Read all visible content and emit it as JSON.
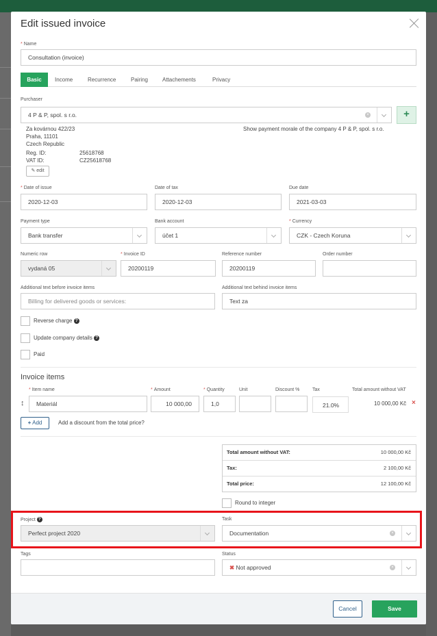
{
  "modal": {
    "title": "Edit issued invoice"
  },
  "name_field": {
    "label": "Name",
    "value": "Consultation (invoice)"
  },
  "tabs": [
    {
      "label": "Basic"
    },
    {
      "label": "Income"
    },
    {
      "label": "Recurrence"
    },
    {
      "label": "Pairing"
    },
    {
      "label": "Attachements"
    },
    {
      "label": "Privacy"
    }
  ],
  "purchaser": {
    "label": "Purchaser",
    "value": "4 P & P, spol. s r.o.",
    "address": [
      "Za kovárnou 422/23",
      "Praha, 11101",
      "Czech Republic"
    ],
    "reg_id_label": "Reg. ID:",
    "reg_id": "25618768",
    "vat_id_label": "VAT ID:",
    "vat_id": "CZ25618768",
    "edit_label": "edit",
    "payment_morale_link": "Show payment morale of the company 4 P & P, spol. s r.o."
  },
  "dates": {
    "issue_label": "Date of issue",
    "issue": "2020-12-03",
    "tax_label": "Date of tax",
    "tax": "2020-12-03",
    "due_label": "Due date",
    "due": "2021-03-03"
  },
  "payment": {
    "type_label": "Payment type",
    "type": "Bank transfer",
    "bank_label": "Bank account",
    "bank": "účet 1",
    "currency_label": "Currency",
    "currency": "CZK - Czech Koruna"
  },
  "numbers": {
    "numeric_row_label": "Numeric row",
    "numeric_row": "vydaná 05",
    "invoice_id_label": "Invoice ID",
    "invoice_id": "20200119",
    "reference_label": "Reference number",
    "reference": "20200119",
    "order_label": "Order number",
    "order": ""
  },
  "texts": {
    "before_label": "Additional text before invoice items",
    "before": "Billing for delivered goods or services:",
    "behind_label": "Additional text behind invoice items",
    "behind": "Text za"
  },
  "checkboxes": {
    "reverse_charge": "Reverse charge",
    "update_company": "Update company details",
    "paid": "Paid"
  },
  "items": {
    "title": "Invoice items",
    "headers": {
      "item_name": "Item name",
      "amount": "Amount",
      "quantity": "Quantity",
      "unit": "Unit",
      "discount": "Discount %",
      "tax": "Tax",
      "total": "Total amount without VAT"
    },
    "rows": [
      {
        "name": "Materiál",
        "amount": "10 000,00",
        "quantity": "1,0",
        "unit": "",
        "discount": "",
        "tax": "21.0%",
        "total": "10 000,00 Kč"
      }
    ],
    "add_label": "Add",
    "discount_link": "Add a discount from the total price?"
  },
  "totals": [
    {
      "label": "Total amount without VAT:",
      "value": "10 000,00 Kč"
    },
    {
      "label": "Tax:",
      "value": "2 100,00 Kč"
    },
    {
      "label": "Total price:",
      "value": "12 100,00 Kč"
    }
  ],
  "round_label": "Round to integer",
  "project": {
    "label": "Project",
    "value": "Perfect project 2020"
  },
  "task": {
    "label": "Task",
    "value": "Documentation"
  },
  "tags": {
    "label": "Tags",
    "value": ""
  },
  "status": {
    "label": "Status",
    "value": "Not approved"
  },
  "footer": {
    "cancel": "Cancel",
    "save": "Save"
  },
  "colors": {
    "accent": "#27a35d",
    "highlight": "#e8141a",
    "link": "#2f5f8a"
  }
}
